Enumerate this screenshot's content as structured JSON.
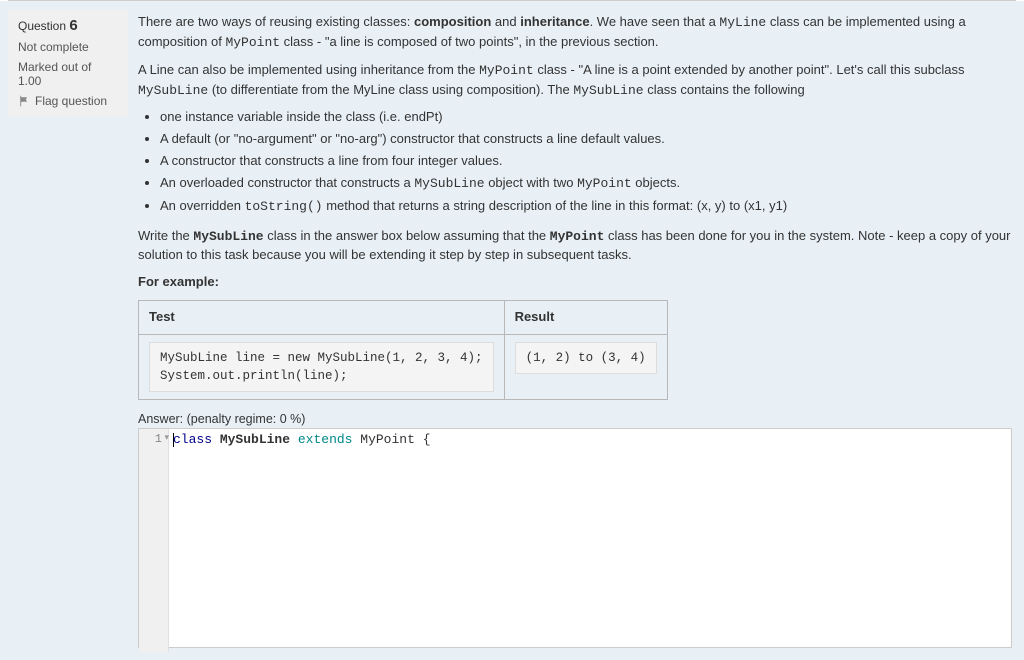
{
  "sidebar": {
    "question_prefix": "Question",
    "question_number": "6",
    "status": "Not complete",
    "marked": "Marked out of 1.00",
    "flag_label": "Flag question"
  },
  "content": {
    "p1_a": "There are two ways of reusing existing classes: ",
    "p1_b": "composition",
    "p1_c": " and ",
    "p1_d": "inheritance",
    "p1_e": ". We have seen that a ",
    "p1_f": "MyLine",
    "p1_g": " class can be implemented using a composition of ",
    "p1_h": "MyPoint",
    "p1_i": " class - \"a line is composed of two points\", in the previous section.",
    "p2_a": "A Line can also be implemented using inheritance from the ",
    "p2_b": "MyPoint",
    "p2_c": " class - \"A line is a point extended by another point\". Let's call this subclass ",
    "p2_d": "MySubLine",
    "p2_e": " (to differentiate from the MyLine class using composition). The ",
    "p2_f": "MySubLine",
    "p2_g": " class contains the following",
    "li1": "one instance variable inside the class (i.e. endPt)",
    "li2": "A default (or \"no-argument\" or \"no-arg\") constructor that constructs a line default values.",
    "li3": "A constructor that constructs a line from four integer values.",
    "li4_a": "An overloaded constructor that constructs a ",
    "li4_b": "MySubLine",
    "li4_c": " object with two ",
    "li4_d": "MyPoint",
    "li4_e": " objects.",
    "li5_a": "An overridden ",
    "li5_b": "toString()",
    "li5_c": " method that returns a string description of the line in this format: (x, y) to (x1, y1)",
    "p3_a": "Write the ",
    "p3_b": "MySubLine",
    "p3_c": " class in the answer box below assuming that the ",
    "p3_d": "MyPoint",
    "p3_e": " class has been done for you in the system. Note - keep a copy of your solution to this task because you will be extending it step by step in subsequent tasks.",
    "for_example": "For example:",
    "th_test": "Test",
    "th_result": "Result",
    "test_code": "MySubLine line = new MySubLine(1, 2, 3, 4);\nSystem.out.println(line);",
    "test_result": "(1, 2) to (3, 4)",
    "answer_label": "Answer:  (penalty regime: 0 %)",
    "editor_line_number": "1",
    "editor_kw_class": "class",
    "editor_type": "MySubLine",
    "editor_kw_extends": "extends",
    "editor_super": "MyPoint",
    "editor_brace": "{"
  }
}
